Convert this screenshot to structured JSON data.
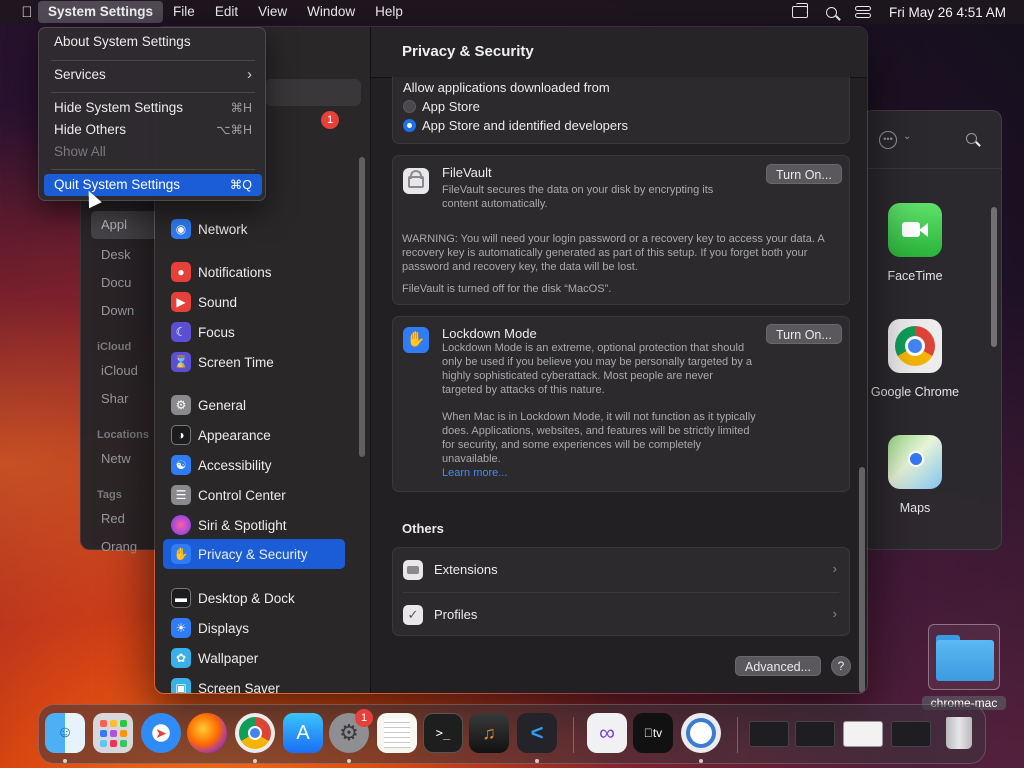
{
  "menubar": {
    "app_name": "System Settings",
    "items": [
      "File",
      "Edit",
      "View",
      "Window",
      "Help"
    ],
    "clock": "Fri May 26  4:51 AM"
  },
  "app_menu": {
    "items": [
      {
        "label": "About System Settings",
        "shortcut": ""
      },
      {
        "label": "Services",
        "shortcut": "›"
      },
      {
        "label": "Hide System Settings",
        "shortcut": "⌘H"
      },
      {
        "label": "Hide Others",
        "shortcut": "⌥⌘H"
      },
      {
        "label": "Show All",
        "shortcut": ""
      },
      {
        "label": "Quit System Settings",
        "shortcut": "⌘Q"
      }
    ]
  },
  "finder": {
    "items": [
      "Appl",
      "Desk",
      "Docu",
      "Down",
      "iCloud",
      "Shar",
      "Netw",
      "Red",
      "Orang"
    ],
    "sections": [
      "iCloud",
      "Locations",
      "Tags"
    ]
  },
  "settings": {
    "title": "Privacy & Security",
    "badge_count": "1",
    "sidebar": [
      {
        "label": "Network",
        "icon": "globe-icon",
        "color": "#2f7cf6"
      },
      {
        "label": "Notifications",
        "icon": "bell-icon",
        "color": "#e5413a"
      },
      {
        "label": "Sound",
        "icon": "speaker-icon",
        "color": "#e5413a"
      },
      {
        "label": "Focus",
        "icon": "moon-icon",
        "color": "#5b4fd6"
      },
      {
        "label": "Screen Time",
        "icon": "hourglass-icon",
        "color": "#5b4fd6"
      },
      {
        "label": "General",
        "icon": "gear-icon",
        "color": "#8a8a8e"
      },
      {
        "label": "Appearance",
        "icon": "appearance-icon",
        "color": "#1c1c1e"
      },
      {
        "label": "Accessibility",
        "icon": "accessibility-icon",
        "color": "#2f7cf6"
      },
      {
        "label": "Control Center",
        "icon": "control-center-icon",
        "color": "#8a8a8e"
      },
      {
        "label": "Siri & Spotlight",
        "icon": "siri-icon",
        "color": "#b04ad6"
      },
      {
        "label": "Privacy & Security",
        "icon": "hand-icon",
        "color": "#2f7cf6"
      },
      {
        "label": "Desktop & Dock",
        "icon": "dock-icon",
        "color": "#1c1c1e"
      },
      {
        "label": "Displays",
        "icon": "sun-icon",
        "color": "#2f7cf6"
      },
      {
        "label": "Wallpaper",
        "icon": "wallpaper-icon",
        "color": "#3ab0e8"
      },
      {
        "label": "Screen Saver",
        "icon": "screensaver-icon",
        "color": "#3ab0e8"
      }
    ],
    "allow_apps": {
      "heading": "Allow applications downloaded from",
      "option_app_store": "App Store",
      "option_identified": "App Store and identified developers",
      "selected": "App Store and identified developers"
    },
    "filevault": {
      "title": "FileVault",
      "description": "FileVault secures the data on your disk by encrypting its content automatically.",
      "warning": "WARNING: You will need your login password or a recovery key to access your data. A recovery key is automatically generated as part of this setup. If you forget both your password and recovery key, the data will be lost.",
      "status": "FileVault is turned off for the disk “MacOS”.",
      "button": "Turn On..."
    },
    "lockdown": {
      "title": "Lockdown Mode",
      "description": "Lockdown Mode is an extreme, optional protection that should only be used if you believe you may be personally targeted by a highly sophisticated cyberattack. Most people are never targeted by attacks of this nature.",
      "details": "When Mac is in Lockdown Mode, it will not function as it typically does. Applications, websites, and features will be strictly limited for security, and some experiences will be completely unavailable.",
      "link": "Learn more...",
      "button": "Turn On..."
    },
    "others": {
      "heading": "Others",
      "rows": [
        "Extensions",
        "Profiles"
      ]
    },
    "advanced_button": "Advanced...",
    "help_button": "?"
  },
  "app_window": {
    "apps": [
      {
        "label": "FaceTime",
        "icon": "facetime-icon"
      },
      {
        "label": "Google Chrome",
        "icon": "chrome-icon"
      },
      {
        "label": "Maps",
        "icon": "maps-icon"
      }
    ]
  },
  "desktop": {
    "folder_label": "chrome-mac"
  },
  "dock": {
    "apps": [
      "Finder",
      "Launchpad",
      "Safari",
      "Firefox",
      "Google Chrome",
      "App Store",
      "System Settings",
      "TextEdit",
      "Terminal",
      "Instruments",
      "Visual Studio Code",
      "Visual Studio",
      "Apple TV",
      "Chrome Canary"
    ],
    "settings_badge": "1"
  }
}
